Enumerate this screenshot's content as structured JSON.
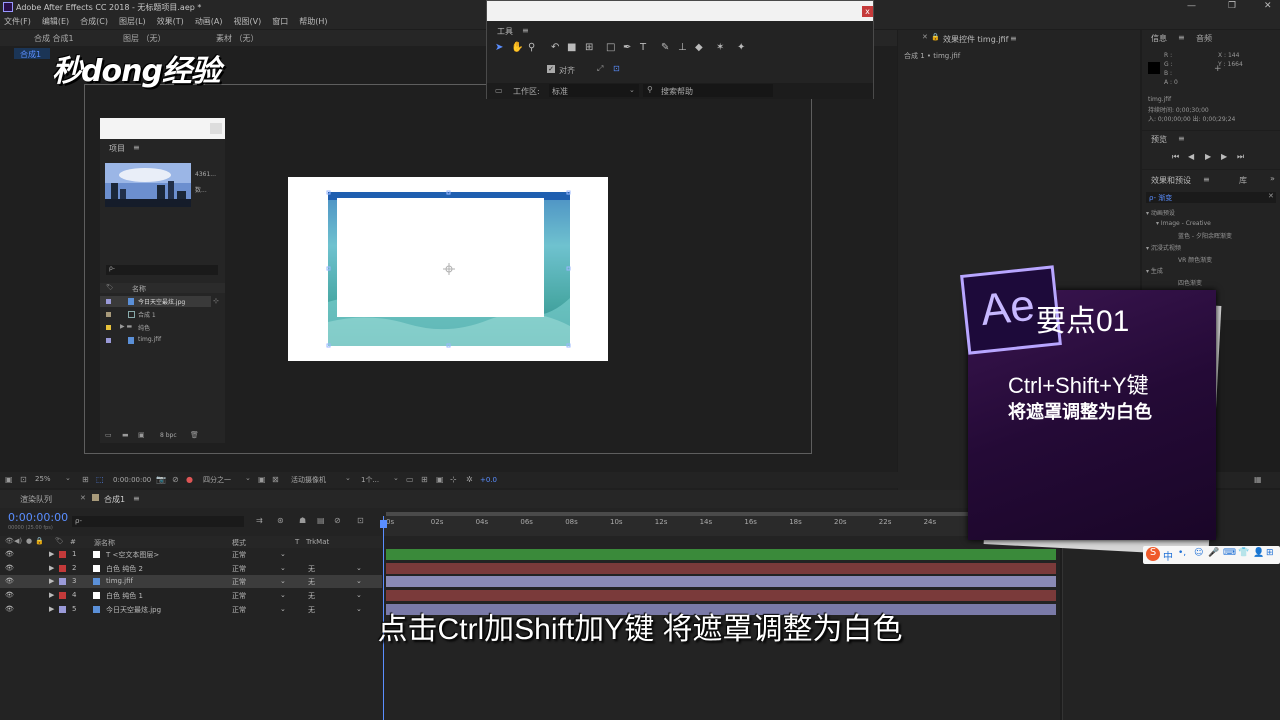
{
  "window": {
    "title": "Adobe After Effects CC 2018 - 无标题项目.aep *"
  },
  "menu": [
    "文件(F)",
    "编辑(E)",
    "合成(C)",
    "图层(L)",
    "效果(T)",
    "动画(A)",
    "视图(V)",
    "窗口",
    "帮助(H)"
  ],
  "watermark": "秒dong经验",
  "comp_viewer": {
    "tab": "合成 合成1",
    "sub_tab": "合成1",
    "layer_tab": "图层 （无）",
    "footage_tab": "素材 （无）"
  },
  "project": {
    "title": "项目",
    "search_placeholder": "ρ-",
    "col_name": "名称",
    "items": [
      "今日天空最炫.jpg",
      "合成 1",
      "纯色",
      "timg.jfif"
    ],
    "thumb_info": [
      "4361...",
      "数..."
    ],
    "bpc": "8 bpc"
  },
  "tools": {
    "title": "工具",
    "snap": "对齐",
    "workspace_label": "工作区:",
    "workspace": "标准",
    "help_search": "搜索帮助"
  },
  "effect_controls": {
    "title": "效果控件 timg.jfif",
    "sub": "合成 1 • timg.jfif"
  },
  "info": {
    "title": "信息",
    "audio": "音频",
    "rgba": [
      "R :",
      "G :",
      "B :",
      "A : 0"
    ],
    "x": "X : 144",
    "y": "Y : 1664",
    "file": "timg.jfif",
    "duration": "持续时间: 0;00;30;00",
    "io": "入: 0;00;00;00  出: 0;00;29;24"
  },
  "preview": {
    "title": "预览"
  },
  "effects": {
    "title": "效果和预设",
    "lib": "库",
    "search": "ρ- 渐变",
    "items": [
      "▾ 动画预设",
      "▾ Image - Creative",
      "蓝色 - 夕阳余晖渐变",
      "▾ 沉浸式视频",
      "VR 颜色渐变",
      "▾ 生成",
      "四色渐变"
    ]
  },
  "viewer_bar": {
    "zoom": "25%",
    "time": "0:00:00:00",
    "res": "四分之一",
    "camera": "活动摄像机",
    "views": "1个...",
    "offset": "+0.0"
  },
  "timeline": {
    "render_tab": "渲染队列",
    "comp_tab": "合成1",
    "timecode": "0:00:00:00",
    "fps": "00000 (25.00 fps)",
    "col_source": "源名称",
    "col_mode": "模式",
    "col_t": "T",
    "col_trkmat": "TrkMat",
    "rulers": [
      "0s",
      "02s",
      "04s",
      "06s",
      "08s",
      "10s",
      "12s",
      "14s",
      "16s",
      "18s",
      "20s",
      "22s",
      "24s"
    ],
    "layers": [
      {
        "num": "1",
        "name": "T  <空文本图层>",
        "mode": "正常",
        "trk": "",
        "color": "#c33a3a",
        "bar": "#3a8a3a"
      },
      {
        "num": "2",
        "name": "白色 纯色 2",
        "mode": "正常",
        "trk": "无",
        "color": "#c33a3a",
        "bar": "#7a3a3a"
      },
      {
        "num": "3",
        "name": "timg.jfif",
        "mode": "正常",
        "trk": "无",
        "color": "#9a9ad8",
        "bar": "#8a8ab5"
      },
      {
        "num": "4",
        "name": "白色 纯色 1",
        "mode": "正常",
        "trk": "无",
        "color": "#c33a3a",
        "bar": "#7a3a3a"
      },
      {
        "num": "5",
        "name": "今日天空最炫.jpg",
        "mode": "正常",
        "trk": "无",
        "color": "#9a9ad8",
        "bar": "#7a7aa8"
      }
    ]
  },
  "tip_card": {
    "logo": "Ae",
    "title": "要点01",
    "line1": "Ctrl+Shift+Y键",
    "line2": "将遮罩调整为白色"
  },
  "subtitle": "点击Ctrl加Shift加Y键 将遮罩调整为白色",
  "ime": [
    "S",
    "中",
    "•,",
    "☺",
    "🎤",
    "⌨",
    "👕",
    "👤",
    "⊞"
  ],
  "colors": {
    "accent": "#5a8eff",
    "ae_purple": "#2a0f4a",
    "bg": "#1d1d1d"
  }
}
